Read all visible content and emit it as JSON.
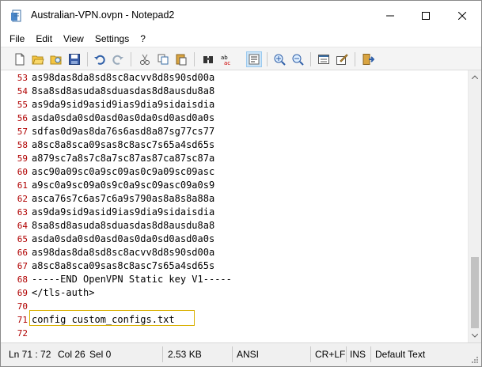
{
  "window": {
    "title": "Australian-VPN.ovpn - Notepad2",
    "app_icon": "notepad2-icon",
    "caption_buttons": [
      "minimize-icon",
      "maximize-icon",
      "close-icon"
    ]
  },
  "menu": {
    "items": [
      "File",
      "Edit",
      "View",
      "Settings",
      "?"
    ]
  },
  "toolbar": {
    "buttons": [
      "new-file-icon",
      "open-file-icon",
      "browse-icon",
      "save-icon",
      "undo-icon",
      "redo-icon",
      "cut-icon",
      "copy-icon",
      "paste-icon",
      "find-icon",
      "replace-icon",
      "word-wrap-icon",
      "zoom-in-icon",
      "zoom-out-icon",
      "scheme-icon",
      "customize-schemes-icon",
      "exit-icon"
    ]
  },
  "editor": {
    "lines": [
      {
        "n": "53",
        "text": "as98das8da8sd8sc8acvv8d8s90sd00a"
      },
      {
        "n": "54",
        "text": "8sa8sd8asuda8sduasdas8d8ausdu8a8"
      },
      {
        "n": "55",
        "text": "as9da9sid9asid9ias9dia9sidaisdia"
      },
      {
        "n": "56",
        "text": "asda0sda0sd0asd0as0da0sd0asd0a0s"
      },
      {
        "n": "57",
        "text": "sdfas0d9as8da76s6asd8a87sg77cs77"
      },
      {
        "n": "58",
        "text": "a8sc8a8sca09sas8c8asc7s65a4sd65s"
      },
      {
        "n": "59",
        "text": "a879sc7a8s7c8a7sc87as87ca87sc87a"
      },
      {
        "n": "60",
        "text": "asc90a09sc0a9sc09as0c9a09sc09asc"
      },
      {
        "n": "61",
        "text": "a9sc0a9sc09a0s9c0a9sc09asc09a0s9"
      },
      {
        "n": "62",
        "text": "asca76s7c6as7c6a9s790as8a8s8a88a"
      },
      {
        "n": "63",
        "text": "as9da9sid9asid9ias9dia9sidaisdia"
      },
      {
        "n": "64",
        "text": "8sa8sd8asuda8sduasdas8d8ausdu8a8"
      },
      {
        "n": "65",
        "text": "asda0sda0sd0asd0as0da0sd0asd0a0s"
      },
      {
        "n": "66",
        "text": "as98das8da8sd8sc8acvv8d8s90sd00a"
      },
      {
        "n": "67",
        "text": "a8sc8a8sca09sas8c8asc7s65a4sd65s"
      },
      {
        "n": "68",
        "text": "-----END OpenVPN Static key V1-----"
      },
      {
        "n": "69",
        "text": "</tls-auth>"
      },
      {
        "n": "70",
        "text": ""
      },
      {
        "n": "71",
        "text": "config custom_configs.txt"
      },
      {
        "n": "72",
        "text": ""
      }
    ]
  },
  "statusbar": {
    "position": "Ln 71 : 72",
    "column": "Col 26",
    "selection": "Sel 0",
    "size": "2.53 KB",
    "encoding": "ANSI",
    "line_endings": "CR+LF",
    "insert_mode": "INS",
    "scheme": "Default Text"
  },
  "colors": {
    "line_numbers": "#b00000",
    "current_line_border": "#d9b000",
    "toolbar_bg": "#f4f4f4",
    "statusbar_bg": "#f0f0f0"
  }
}
